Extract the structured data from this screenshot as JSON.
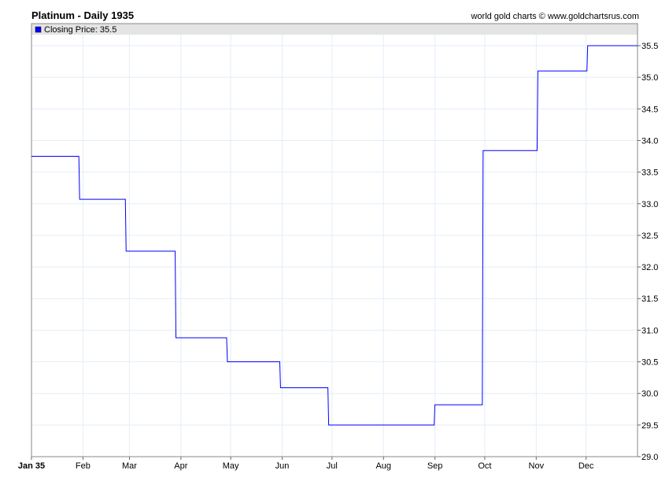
{
  "chart_data": {
    "type": "line",
    "title": "Platinum - Daily 1935",
    "credit": "world gold charts © www.goldchartsrus.com",
    "legend": {
      "label": "Closing Price: 35.5",
      "placement": "top-left"
    },
    "series": [
      {
        "name": "Closing Price",
        "color": "#0000ff",
        "step_days": [
          0,
          29,
          57,
          87,
          118,
          150,
          179,
          243,
          272,
          305,
          335,
          364
        ],
        "values": [
          33.75,
          33.07,
          32.25,
          30.88,
          30.5,
          30.09,
          29.5,
          29.82,
          33.84,
          35.1,
          35.5,
          35.5
        ]
      }
    ],
    "x_ticks": [
      {
        "label": "Jan 35",
        "day": 0
      },
      {
        "label": "Feb",
        "day": 31
      },
      {
        "label": "Mar",
        "day": 59
      },
      {
        "label": "Apr",
        "day": 90
      },
      {
        "label": "May",
        "day": 120
      },
      {
        "label": "Jun",
        "day": 151
      },
      {
        "label": "Jul",
        "day": 181
      },
      {
        "label": "Aug",
        "day": 212
      },
      {
        "label": "Sep",
        "day": 243
      },
      {
        "label": "Oct",
        "day": 273
      },
      {
        "label": "Nov",
        "day": 304
      },
      {
        "label": "Dec",
        "day": 334
      }
    ],
    "y_ticks": [
      "29.0",
      "29.5",
      "30.0",
      "30.5",
      "31.0",
      "31.5",
      "32.0",
      "32.5",
      "33.0",
      "33.5",
      "34.0",
      "34.5",
      "35.0",
      "35.5"
    ],
    "xlim": [
      0,
      365
    ],
    "ylim": [
      29.0,
      35.5
    ],
    "grid": true
  }
}
